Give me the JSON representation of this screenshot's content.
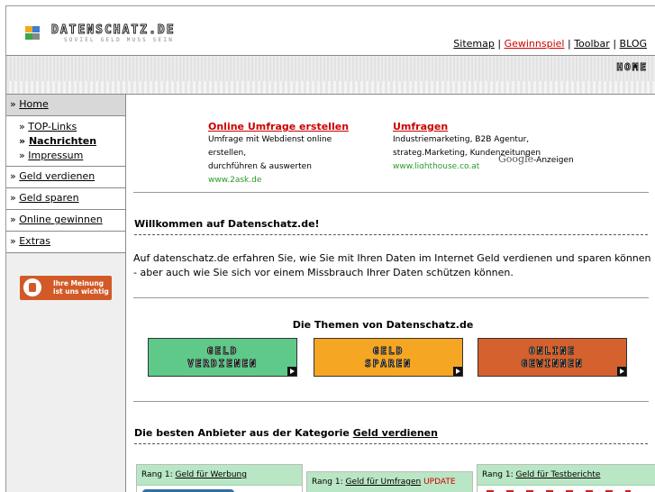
{
  "header": {
    "logo_text": "DATENSCHATZ.DE",
    "logo_subtitle": "SOVIEL GELD MUSS SEIN",
    "links": [
      "Sitemap",
      "Gewinnspiel",
      "Toolbar",
      "BLOG"
    ],
    "separator": "|"
  },
  "navbar": {
    "home_label": "HOME"
  },
  "sidebar": {
    "home": "Home",
    "sub_items": [
      "TOP-Links",
      "Nachrichten",
      "Impressum"
    ],
    "items": [
      "Geld verdienen",
      "Geld sparen",
      "Online gewinnen",
      "Extras"
    ],
    "prefix": "»",
    "feedback_line1": "Ihre Meinung",
    "feedback_line2": "ist uns wichtig"
  },
  "ads": [
    {
      "title": "Online Umfrage erstellen",
      "line1": "Umfrage mit Webdienst online erstellen,",
      "line2": "durchführen & auswerten",
      "url": "www.2ask.de"
    },
    {
      "title": "Umfragen",
      "line1": "Industriemarketing, B2B Agentur,",
      "line2": "strateg.Marketing, Kundenzeitungen",
      "url": "www.lighthouse.co.at"
    }
  ],
  "google_ads_label": "Google",
  "google_ads_suffix": "-Anzeigen",
  "welcome_heading": "Willkommen auf Datenschatz.de!",
  "intro_text": "Auf datenschatz.de erfahren Sie, wie Sie mit Ihren Daten im Internet Geld verdienen und sparen können - aber auch wie Sie sich vor einem Missbrauch Ihrer Daten schützen können.",
  "themes_heading": "Die Themen von Datenschatz.de",
  "theme_buttons": [
    {
      "line1": "GELD",
      "line2": "VERDIENEN",
      "color": "#5fc98a"
    },
    {
      "line1": "GELD",
      "line2": "SPAREN",
      "color": "#f5a623"
    },
    {
      "line1": "ONLINE",
      "line2": "GEWINNEN",
      "color": "#d4612e"
    }
  ],
  "best_heading_prefix": "Die besten Anbieter aus der Kategorie",
  "best_heading_link": "Geld verdienen",
  "cards": [
    {
      "rank": "Rang 1:",
      "link": "Geld für Werbung",
      "badge": ""
    },
    {
      "rank": "Rang 1:",
      "link": "Geld für Umfragen",
      "badge": "UPDATE"
    },
    {
      "rank": "Rang 1:",
      "link": "Geld für Testberichte",
      "badge": ""
    }
  ]
}
